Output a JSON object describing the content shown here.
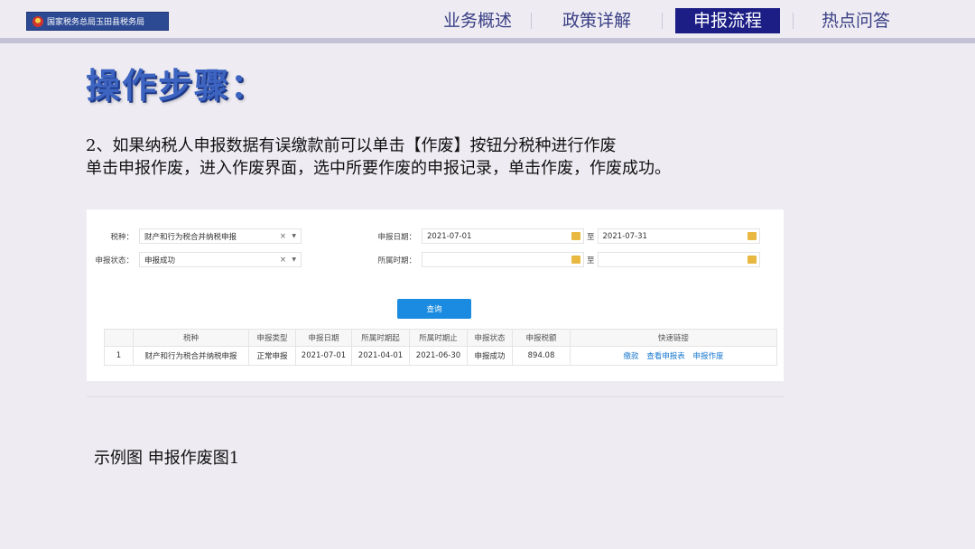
{
  "header": {
    "logo_text": "国家税务总局玉田县税务局",
    "nav": [
      {
        "label": "业务概述",
        "active": false
      },
      {
        "label": "政策详解",
        "active": false
      },
      {
        "label": "申报流程",
        "active": true
      },
      {
        "label": "热点问答",
        "active": false
      }
    ]
  },
  "title": "操作步骤：",
  "paragraphs": [
    "2、如果纳税人申报数据有误缴款前可以单击【作废】按钮分税种进行作废",
    "单击申报作废，进入作废界面，选中所要作废的申报记录，单击作废，作废成功。"
  ],
  "form": {
    "tax_type_label": "税种：",
    "tax_type_value": "财产和行为税合并纳税申报",
    "status_label": "申报状态：",
    "status_value": "申报成功",
    "clear_symbol": "×",
    "declare_date_label": "申报日期：",
    "declare_date_from": "2021-07-01",
    "declare_date_to": "2021-07-31",
    "period_label": "所属时期：",
    "period_from": "",
    "period_to": "",
    "to_label": "至",
    "query_button": "查询"
  },
  "table": {
    "headers": [
      "",
      "税种",
      "申报类型",
      "申报日期",
      "所属时期起",
      "所属时期止",
      "申报状态",
      "申报税额",
      "快速链接"
    ],
    "rows": [
      {
        "index": "1",
        "tax_type": "财产和行为税合并纳税申报",
        "declare_type": "正常申报",
        "declare_date": "2021-07-01",
        "period_start": "2021-04-01",
        "period_end": "2021-06-30",
        "status": "申报成功",
        "amount": "894.08",
        "links": [
          "缴款",
          "查看申报表",
          "申报作废"
        ]
      }
    ]
  },
  "caption": "示例图  申报作废图1",
  "colors": {
    "nav_active": "#1c1e86",
    "title": "#3c64c0",
    "button": "#1a8be0",
    "link": "#1a78d0"
  }
}
